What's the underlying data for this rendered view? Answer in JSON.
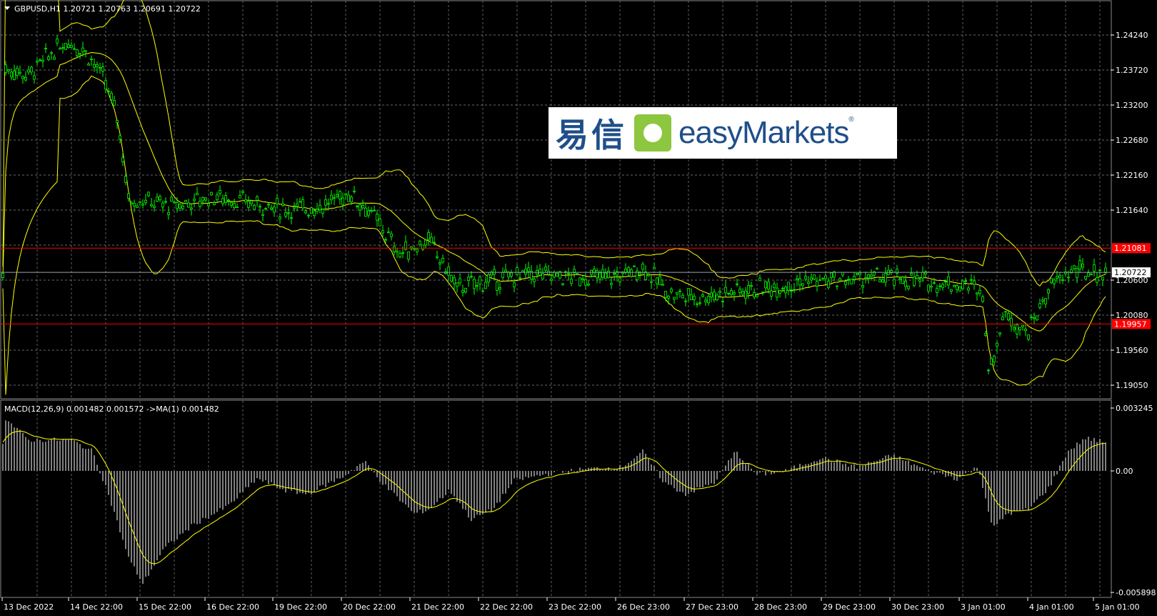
{
  "header": {
    "title": "GBPUSD,H1  1.20721 1.20763 1.20691 1.20722",
    "menu_arrow": "triangle-down-icon"
  },
  "price_axis": {
    "ticks": [
      "1.24240",
      "1.23720",
      "1.23200",
      "1.22680",
      "1.22160",
      "1.21640",
      "1.20600",
      "1.20080",
      "1.19560",
      "1.19050"
    ],
    "current_price": "1.20722",
    "upper_level": "1.21081",
    "lower_level": "1.19957"
  },
  "macd": {
    "label": "MACD(12,26,9) 0.001482 0.001572  ->MA(1) 0.001482",
    "axis_ticks": [
      "0.003245",
      "0.00",
      "-0.005898"
    ]
  },
  "time_axis": {
    "labels": [
      "13 Dec 2022",
      "14 Dec 22:00",
      "15 Dec 22:00",
      "16 Dec 22:00",
      "19 Dec 22:00",
      "20 Dec 22:00",
      "21 Dec 22:00",
      "22 Dec 22:00",
      "23 Dec 22:00",
      "26 Dec 23:00",
      "27 Dec 23:00",
      "28 Dec 23:00",
      "29 Dec 23:00",
      "30 Dec 23:00",
      "3 Jan 01:00",
      "4 Jan 01:00",
      "5 Jan 01:00"
    ]
  },
  "logo": {
    "cn_text": "易信",
    "en_text": "easyMarkets",
    "reg": "®"
  },
  "colors": {
    "background": "#000000",
    "grid": "#8a8a8a",
    "candles": "#00ff00",
    "bands": "#ffff00",
    "level_lines": "#ff0000",
    "price_tag_bg": "#ff0000",
    "current_tag_bg": "#ffffff",
    "macd_hist": "#ffffff",
    "macd_signal": "#ffff00"
  },
  "chart_data": {
    "type": "line",
    "title": "GBPUSD,H1",
    "x": [
      "13 Dec 2022",
      "14 Dec 22:00",
      "15 Dec 22:00",
      "16 Dec 22:00",
      "19 Dec 22:00",
      "20 Dec 22:00",
      "21 Dec 22:00",
      "22 Dec 22:00",
      "23 Dec 22:00",
      "26 Dec 23:00",
      "27 Dec 23:00",
      "28 Dec 23:00",
      "29 Dec 23:00",
      "30 Dec 23:00",
      "3 Jan 01:00",
      "4 Jan 01:00",
      "5 Jan 01:00"
    ],
    "series": [
      {
        "name": "GBPUSD",
        "values": [
          1.237,
          1.241,
          1.217,
          1.219,
          1.215,
          1.218,
          1.208,
          1.205,
          1.2065,
          1.207,
          1.208,
          1.204,
          1.206,
          1.208,
          1.204,
          1.2,
          1.2072
        ]
      },
      {
        "name": "MACD(12,26,9)",
        "values": [
          0.0028,
          0.0025,
          -0.005,
          -0.002,
          -0.0012,
          0.0004,
          -0.002,
          -0.0024,
          0.0,
          0.0008,
          -0.0012,
          0.001,
          0.0006,
          0.0008,
          -0.0005,
          -0.0018,
          0.0015
        ]
      }
    ],
    "ylim": [
      1.188,
      1.246
    ],
    "macd_ylim": [
      -0.005898,
      0.003245
    ],
    "levels": [
      1.21081,
      1.19957
    ],
    "grid": true
  }
}
